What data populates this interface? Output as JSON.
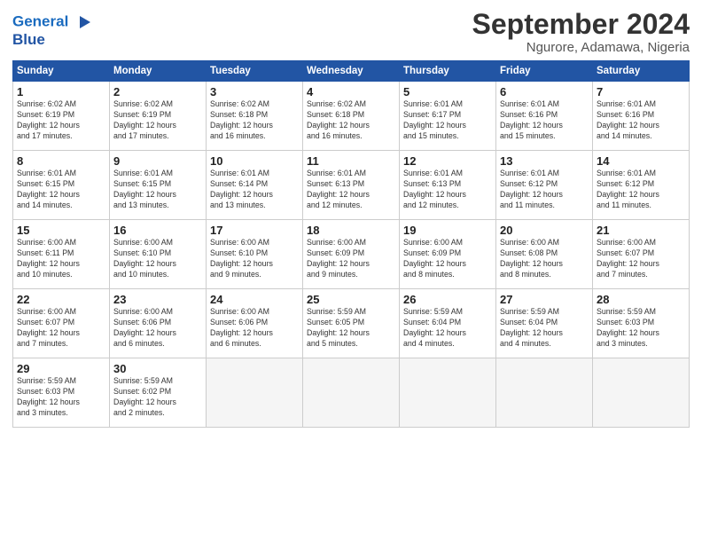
{
  "header": {
    "logo_line1": "General",
    "logo_line2": "Blue",
    "month": "September 2024",
    "location": "Ngurore, Adamawa, Nigeria"
  },
  "days_of_week": [
    "Sunday",
    "Monday",
    "Tuesday",
    "Wednesday",
    "Thursday",
    "Friday",
    "Saturday"
  ],
  "weeks": [
    [
      {
        "day": "1",
        "lines": [
          "Sunrise: 6:02 AM",
          "Sunset: 6:19 PM",
          "Daylight: 12 hours",
          "and 17 minutes."
        ]
      },
      {
        "day": "2",
        "lines": [
          "Sunrise: 6:02 AM",
          "Sunset: 6:19 PM",
          "Daylight: 12 hours",
          "and 17 minutes."
        ]
      },
      {
        "day": "3",
        "lines": [
          "Sunrise: 6:02 AM",
          "Sunset: 6:18 PM",
          "Daylight: 12 hours",
          "and 16 minutes."
        ]
      },
      {
        "day": "4",
        "lines": [
          "Sunrise: 6:02 AM",
          "Sunset: 6:18 PM",
          "Daylight: 12 hours",
          "and 16 minutes."
        ]
      },
      {
        "day": "5",
        "lines": [
          "Sunrise: 6:01 AM",
          "Sunset: 6:17 PM",
          "Daylight: 12 hours",
          "and 15 minutes."
        ]
      },
      {
        "day": "6",
        "lines": [
          "Sunrise: 6:01 AM",
          "Sunset: 6:16 PM",
          "Daylight: 12 hours",
          "and 15 minutes."
        ]
      },
      {
        "day": "7",
        "lines": [
          "Sunrise: 6:01 AM",
          "Sunset: 6:16 PM",
          "Daylight: 12 hours",
          "and 14 minutes."
        ]
      }
    ],
    [
      {
        "day": "8",
        "lines": [
          "Sunrise: 6:01 AM",
          "Sunset: 6:15 PM",
          "Daylight: 12 hours",
          "and 14 minutes."
        ]
      },
      {
        "day": "9",
        "lines": [
          "Sunrise: 6:01 AM",
          "Sunset: 6:15 PM",
          "Daylight: 12 hours",
          "and 13 minutes."
        ]
      },
      {
        "day": "10",
        "lines": [
          "Sunrise: 6:01 AM",
          "Sunset: 6:14 PM",
          "Daylight: 12 hours",
          "and 13 minutes."
        ]
      },
      {
        "day": "11",
        "lines": [
          "Sunrise: 6:01 AM",
          "Sunset: 6:13 PM",
          "Daylight: 12 hours",
          "and 12 minutes."
        ]
      },
      {
        "day": "12",
        "lines": [
          "Sunrise: 6:01 AM",
          "Sunset: 6:13 PM",
          "Daylight: 12 hours",
          "and 12 minutes."
        ]
      },
      {
        "day": "13",
        "lines": [
          "Sunrise: 6:01 AM",
          "Sunset: 6:12 PM",
          "Daylight: 12 hours",
          "and 11 minutes."
        ]
      },
      {
        "day": "14",
        "lines": [
          "Sunrise: 6:01 AM",
          "Sunset: 6:12 PM",
          "Daylight: 12 hours",
          "and 11 minutes."
        ]
      }
    ],
    [
      {
        "day": "15",
        "lines": [
          "Sunrise: 6:00 AM",
          "Sunset: 6:11 PM",
          "Daylight: 12 hours",
          "and 10 minutes."
        ]
      },
      {
        "day": "16",
        "lines": [
          "Sunrise: 6:00 AM",
          "Sunset: 6:10 PM",
          "Daylight: 12 hours",
          "and 10 minutes."
        ]
      },
      {
        "day": "17",
        "lines": [
          "Sunrise: 6:00 AM",
          "Sunset: 6:10 PM",
          "Daylight: 12 hours",
          "and 9 minutes."
        ]
      },
      {
        "day": "18",
        "lines": [
          "Sunrise: 6:00 AM",
          "Sunset: 6:09 PM",
          "Daylight: 12 hours",
          "and 9 minutes."
        ]
      },
      {
        "day": "19",
        "lines": [
          "Sunrise: 6:00 AM",
          "Sunset: 6:09 PM",
          "Daylight: 12 hours",
          "and 8 minutes."
        ]
      },
      {
        "day": "20",
        "lines": [
          "Sunrise: 6:00 AM",
          "Sunset: 6:08 PM",
          "Daylight: 12 hours",
          "and 8 minutes."
        ]
      },
      {
        "day": "21",
        "lines": [
          "Sunrise: 6:00 AM",
          "Sunset: 6:07 PM",
          "Daylight: 12 hours",
          "and 7 minutes."
        ]
      }
    ],
    [
      {
        "day": "22",
        "lines": [
          "Sunrise: 6:00 AM",
          "Sunset: 6:07 PM",
          "Daylight: 12 hours",
          "and 7 minutes."
        ]
      },
      {
        "day": "23",
        "lines": [
          "Sunrise: 6:00 AM",
          "Sunset: 6:06 PM",
          "Daylight: 12 hours",
          "and 6 minutes."
        ]
      },
      {
        "day": "24",
        "lines": [
          "Sunrise: 6:00 AM",
          "Sunset: 6:06 PM",
          "Daylight: 12 hours",
          "and 6 minutes."
        ]
      },
      {
        "day": "25",
        "lines": [
          "Sunrise: 5:59 AM",
          "Sunset: 6:05 PM",
          "Daylight: 12 hours",
          "and 5 minutes."
        ]
      },
      {
        "day": "26",
        "lines": [
          "Sunrise: 5:59 AM",
          "Sunset: 6:04 PM",
          "Daylight: 12 hours",
          "and 4 minutes."
        ]
      },
      {
        "day": "27",
        "lines": [
          "Sunrise: 5:59 AM",
          "Sunset: 6:04 PM",
          "Daylight: 12 hours",
          "and 4 minutes."
        ]
      },
      {
        "day": "28",
        "lines": [
          "Sunrise: 5:59 AM",
          "Sunset: 6:03 PM",
          "Daylight: 12 hours",
          "and 3 minutes."
        ]
      }
    ],
    [
      {
        "day": "29",
        "lines": [
          "Sunrise: 5:59 AM",
          "Sunset: 6:03 PM",
          "Daylight: 12 hours",
          "and 3 minutes."
        ]
      },
      {
        "day": "30",
        "lines": [
          "Sunrise: 5:59 AM",
          "Sunset: 6:02 PM",
          "Daylight: 12 hours",
          "and 2 minutes."
        ]
      },
      null,
      null,
      null,
      null,
      null
    ]
  ]
}
